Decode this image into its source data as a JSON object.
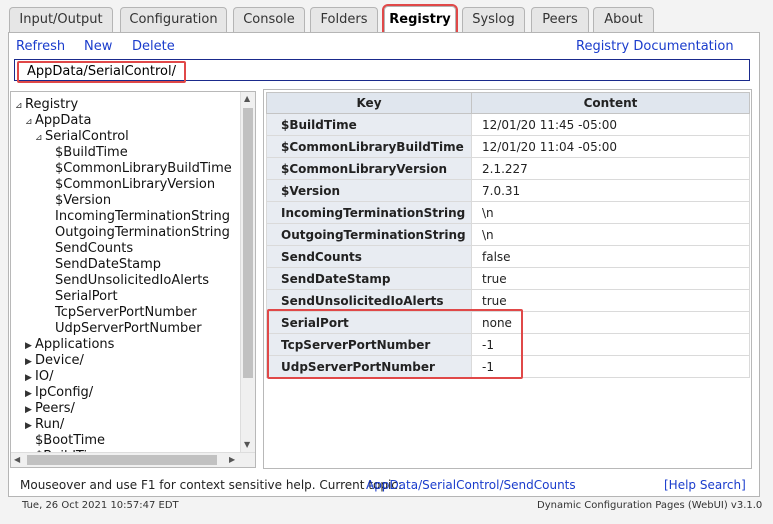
{
  "tabs": [
    {
      "label": "Input/Output",
      "active": false
    },
    {
      "label": "Configuration",
      "active": false
    },
    {
      "label": "Console",
      "active": false
    },
    {
      "label": "Folders",
      "active": false
    },
    {
      "label": "Registry",
      "active": true
    },
    {
      "label": "Syslog",
      "active": false
    },
    {
      "label": "Peers",
      "active": false
    },
    {
      "label": "About",
      "active": false
    }
  ],
  "toolbar": {
    "refresh": "Refresh",
    "new": "New",
    "delete": "Delete",
    "documentation": "Registry Documentation"
  },
  "path": "AppData/SerialControl/",
  "tree": [
    {
      "label": "Registry",
      "twisty": "⊿",
      "depth": 0
    },
    {
      "label": "AppData",
      "twisty": "⊿",
      "depth": 1
    },
    {
      "label": "SerialControl",
      "twisty": "⊿",
      "depth": 2
    },
    {
      "label": "$BuildTime",
      "twisty": "",
      "depth": 3
    },
    {
      "label": "$CommonLibraryBuildTime",
      "twisty": "",
      "depth": 3
    },
    {
      "label": "$CommonLibraryVersion",
      "twisty": "",
      "depth": 3
    },
    {
      "label": "$Version",
      "twisty": "",
      "depth": 3
    },
    {
      "label": "IncomingTerminationString",
      "twisty": "",
      "depth": 3
    },
    {
      "label": "OutgoingTerminationString",
      "twisty": "",
      "depth": 3
    },
    {
      "label": "SendCounts",
      "twisty": "",
      "depth": 3
    },
    {
      "label": "SendDateStamp",
      "twisty": "",
      "depth": 3
    },
    {
      "label": "SendUnsolicitedIoAlerts",
      "twisty": "",
      "depth": 3
    },
    {
      "label": "SerialPort",
      "twisty": "",
      "depth": 3
    },
    {
      "label": "TcpServerPortNumber",
      "twisty": "",
      "depth": 3
    },
    {
      "label": "UdpServerPortNumber",
      "twisty": "",
      "depth": 3
    },
    {
      "label": "Applications",
      "twisty": "▶",
      "depth": 1
    },
    {
      "label": "Device/",
      "twisty": "▶",
      "depth": 1
    },
    {
      "label": "IO/",
      "twisty": "▶",
      "depth": 1
    },
    {
      "label": "IpConfig/",
      "twisty": "▶",
      "depth": 1
    },
    {
      "label": "Peers/",
      "twisty": "▶",
      "depth": 1
    },
    {
      "label": "Run/",
      "twisty": "▶",
      "depth": 1
    },
    {
      "label": "$BootTime",
      "twisty": "",
      "depth": 1
    },
    {
      "label": "$BuildTime",
      "twisty": "",
      "depth": 1
    }
  ],
  "table": {
    "headers": [
      "Key",
      "Content"
    ],
    "rows": [
      {
        "key": "$BuildTime",
        "value": "12/01/20 11:45 -05:00"
      },
      {
        "key": "$CommonLibraryBuildTime",
        "value": "12/01/20 11:04 -05:00"
      },
      {
        "key": "$CommonLibraryVersion",
        "value": "2.1.227"
      },
      {
        "key": "$Version",
        "value": "7.0.31"
      },
      {
        "key": "IncomingTerminationString",
        "value": "\\n"
      },
      {
        "key": "OutgoingTerminationString",
        "value": "\\n"
      },
      {
        "key": "SendCounts",
        "value": "false"
      },
      {
        "key": "SendDateStamp",
        "value": "true"
      },
      {
        "key": "SendUnsolicitedIoAlerts",
        "value": "true"
      },
      {
        "key": "SerialPort",
        "value": "none"
      },
      {
        "key": "TcpServerPortNumber",
        "value": "-1"
      },
      {
        "key": "UdpServerPortNumber",
        "value": "-1"
      }
    ]
  },
  "help": {
    "text": "Mouseover and use F1 for context sensitive help. Current topic:",
    "topic": "AppData/SerialControl/SendCounts",
    "search": "[Help Search]"
  },
  "status": {
    "datetime": "Tue, 26 Oct 2021 10:57:47 EDT",
    "version": "Dynamic Configuration Pages (WebUI) v3.1.0"
  },
  "colors": {
    "highlight": "#e04848",
    "link": "#1a3ccc"
  }
}
